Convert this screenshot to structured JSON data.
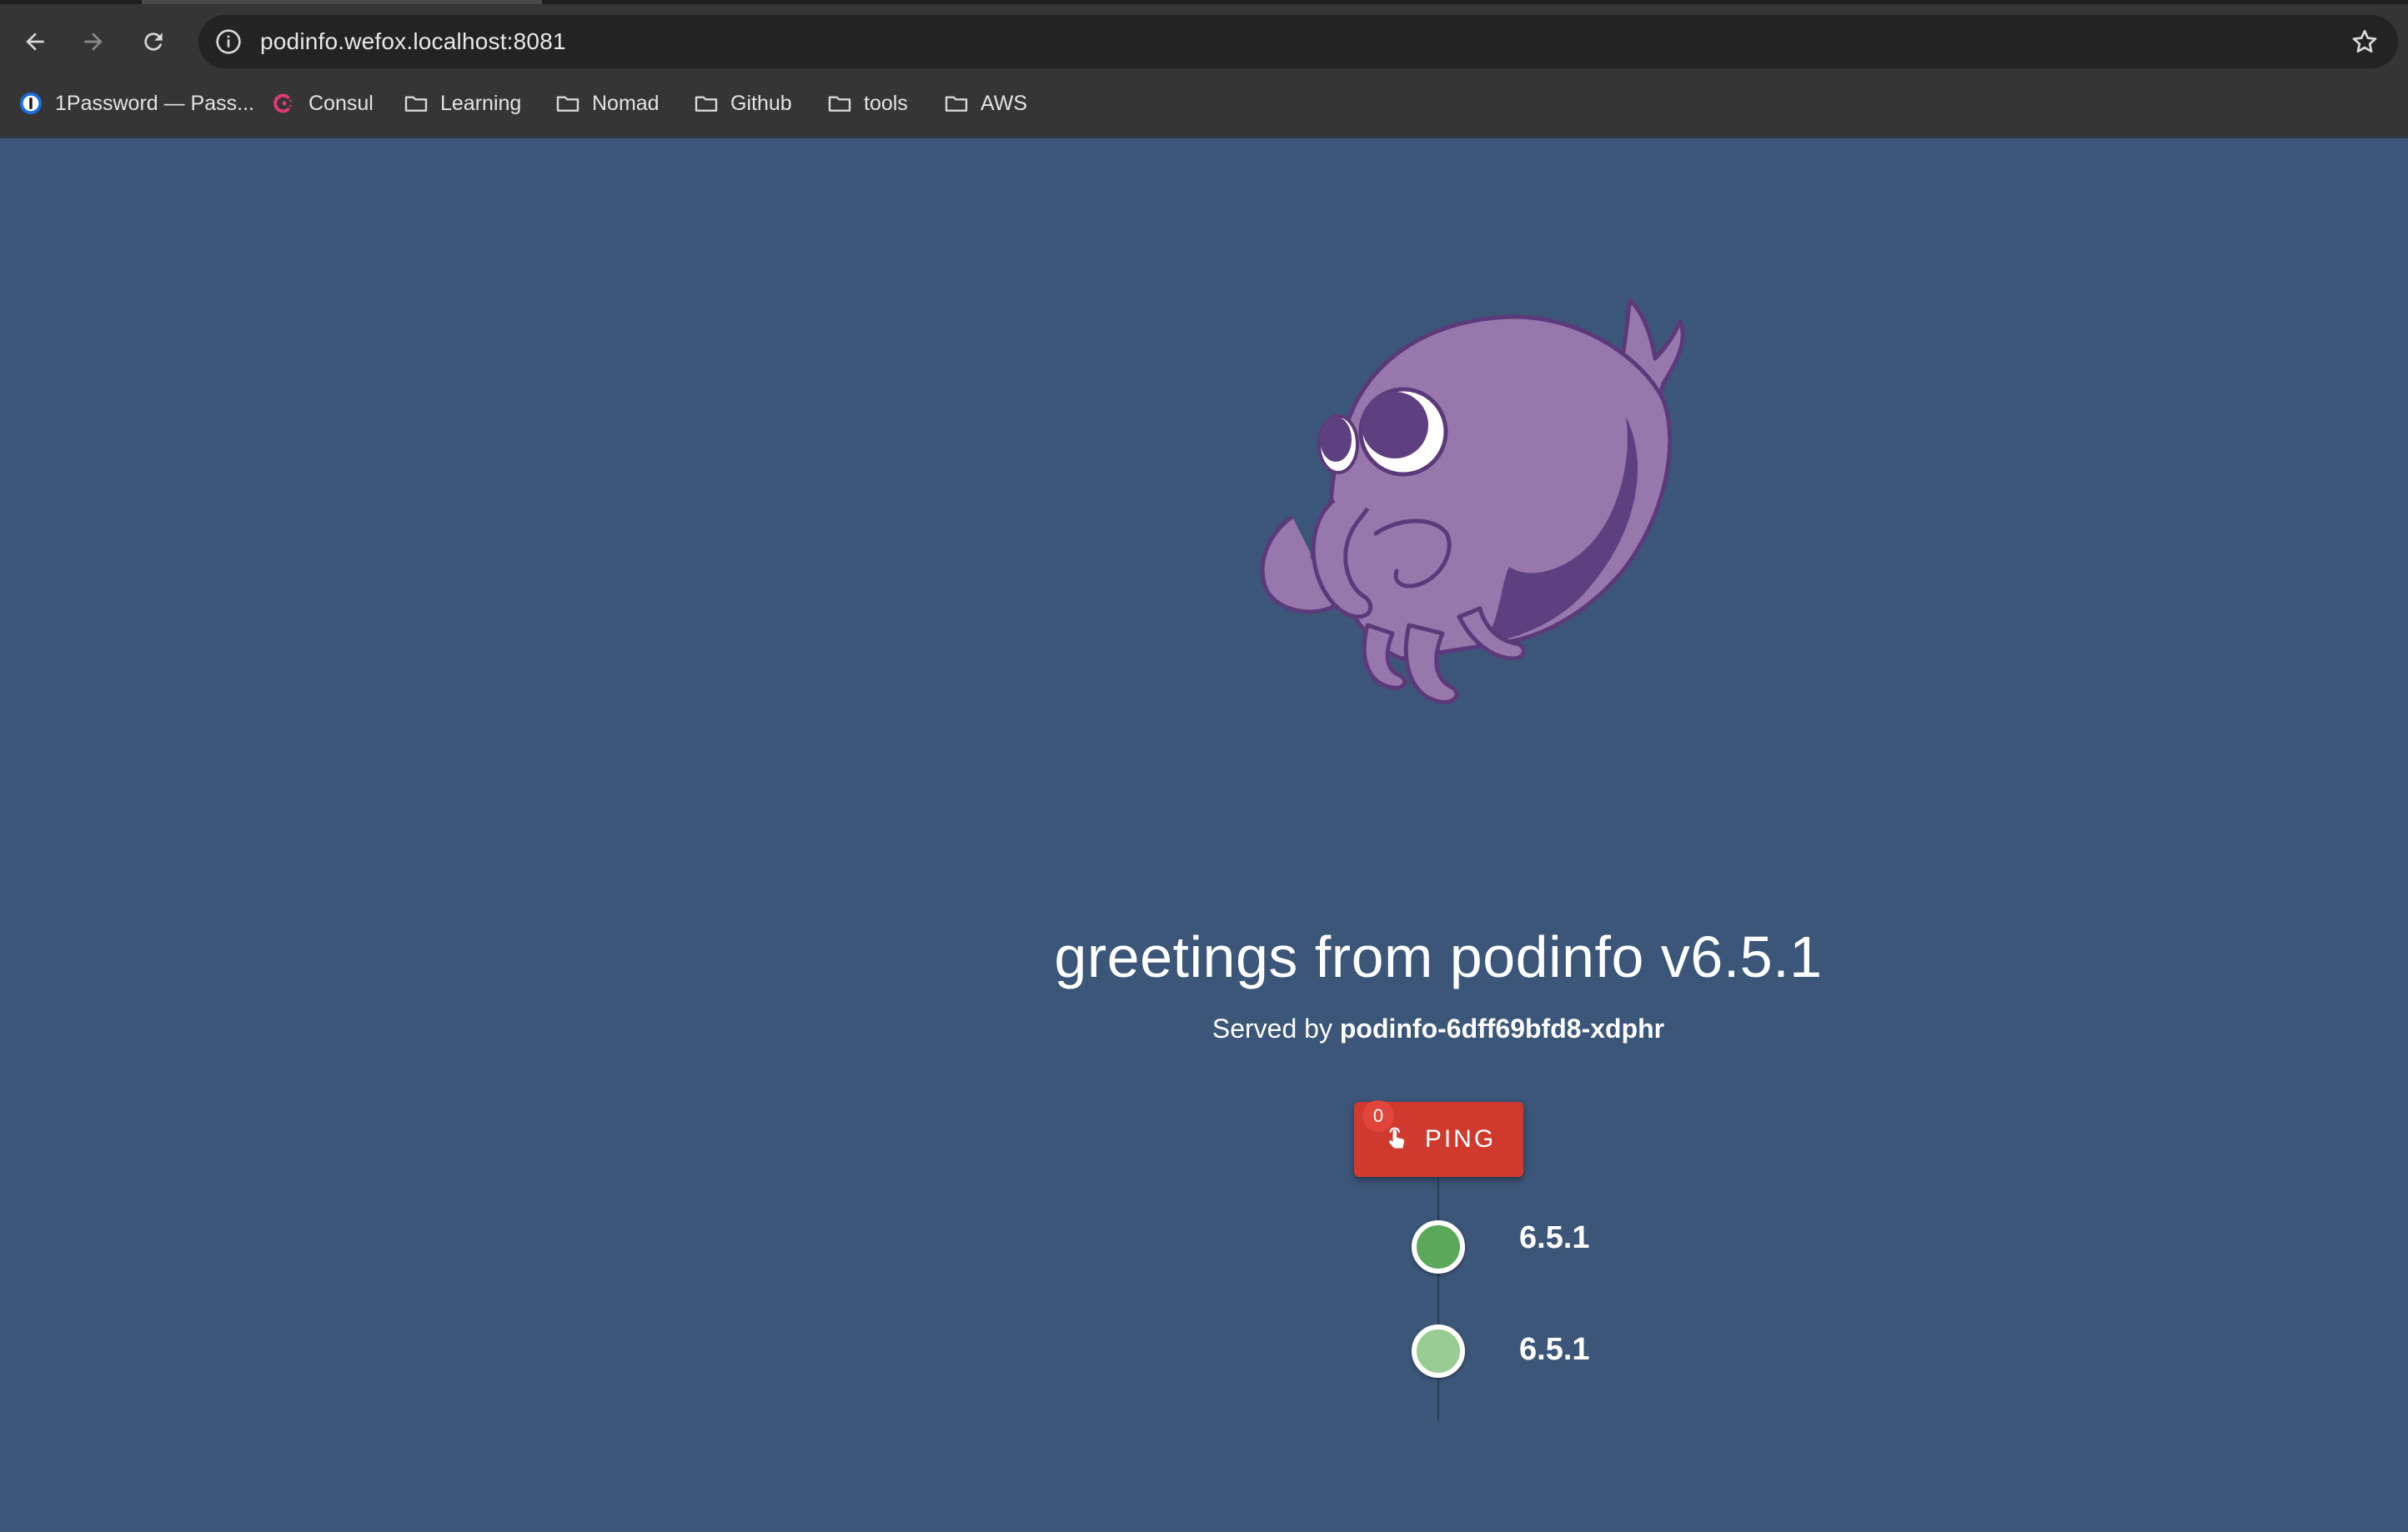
{
  "browser": {
    "url": "podinfo.wefox.localhost:8081",
    "bookmarks": [
      {
        "label": "1Password — Pass...",
        "icon": "1password-icon"
      },
      {
        "label": "Consul",
        "icon": "consul-icon"
      },
      {
        "label": "Learning",
        "icon": "folder-icon"
      },
      {
        "label": "Nomad",
        "icon": "folder-icon"
      },
      {
        "label": "Github",
        "icon": "folder-icon"
      },
      {
        "label": "tools",
        "icon": "folder-icon"
      },
      {
        "label": "AWS",
        "icon": "folder-icon"
      }
    ]
  },
  "page": {
    "background": "#3b5678",
    "title": "greetings from podinfo v6.5.1",
    "served_prefix": "Served by",
    "served_host": "podinfo-6dff69bfd8-xdphr",
    "ping": {
      "label": "PING",
      "count": "0",
      "color": "#d0392e"
    },
    "timeline": [
      {
        "version": "6.5.1",
        "color": "#5ba85a"
      },
      {
        "version": "6.5.1",
        "color": "#99cc93"
      }
    ]
  }
}
